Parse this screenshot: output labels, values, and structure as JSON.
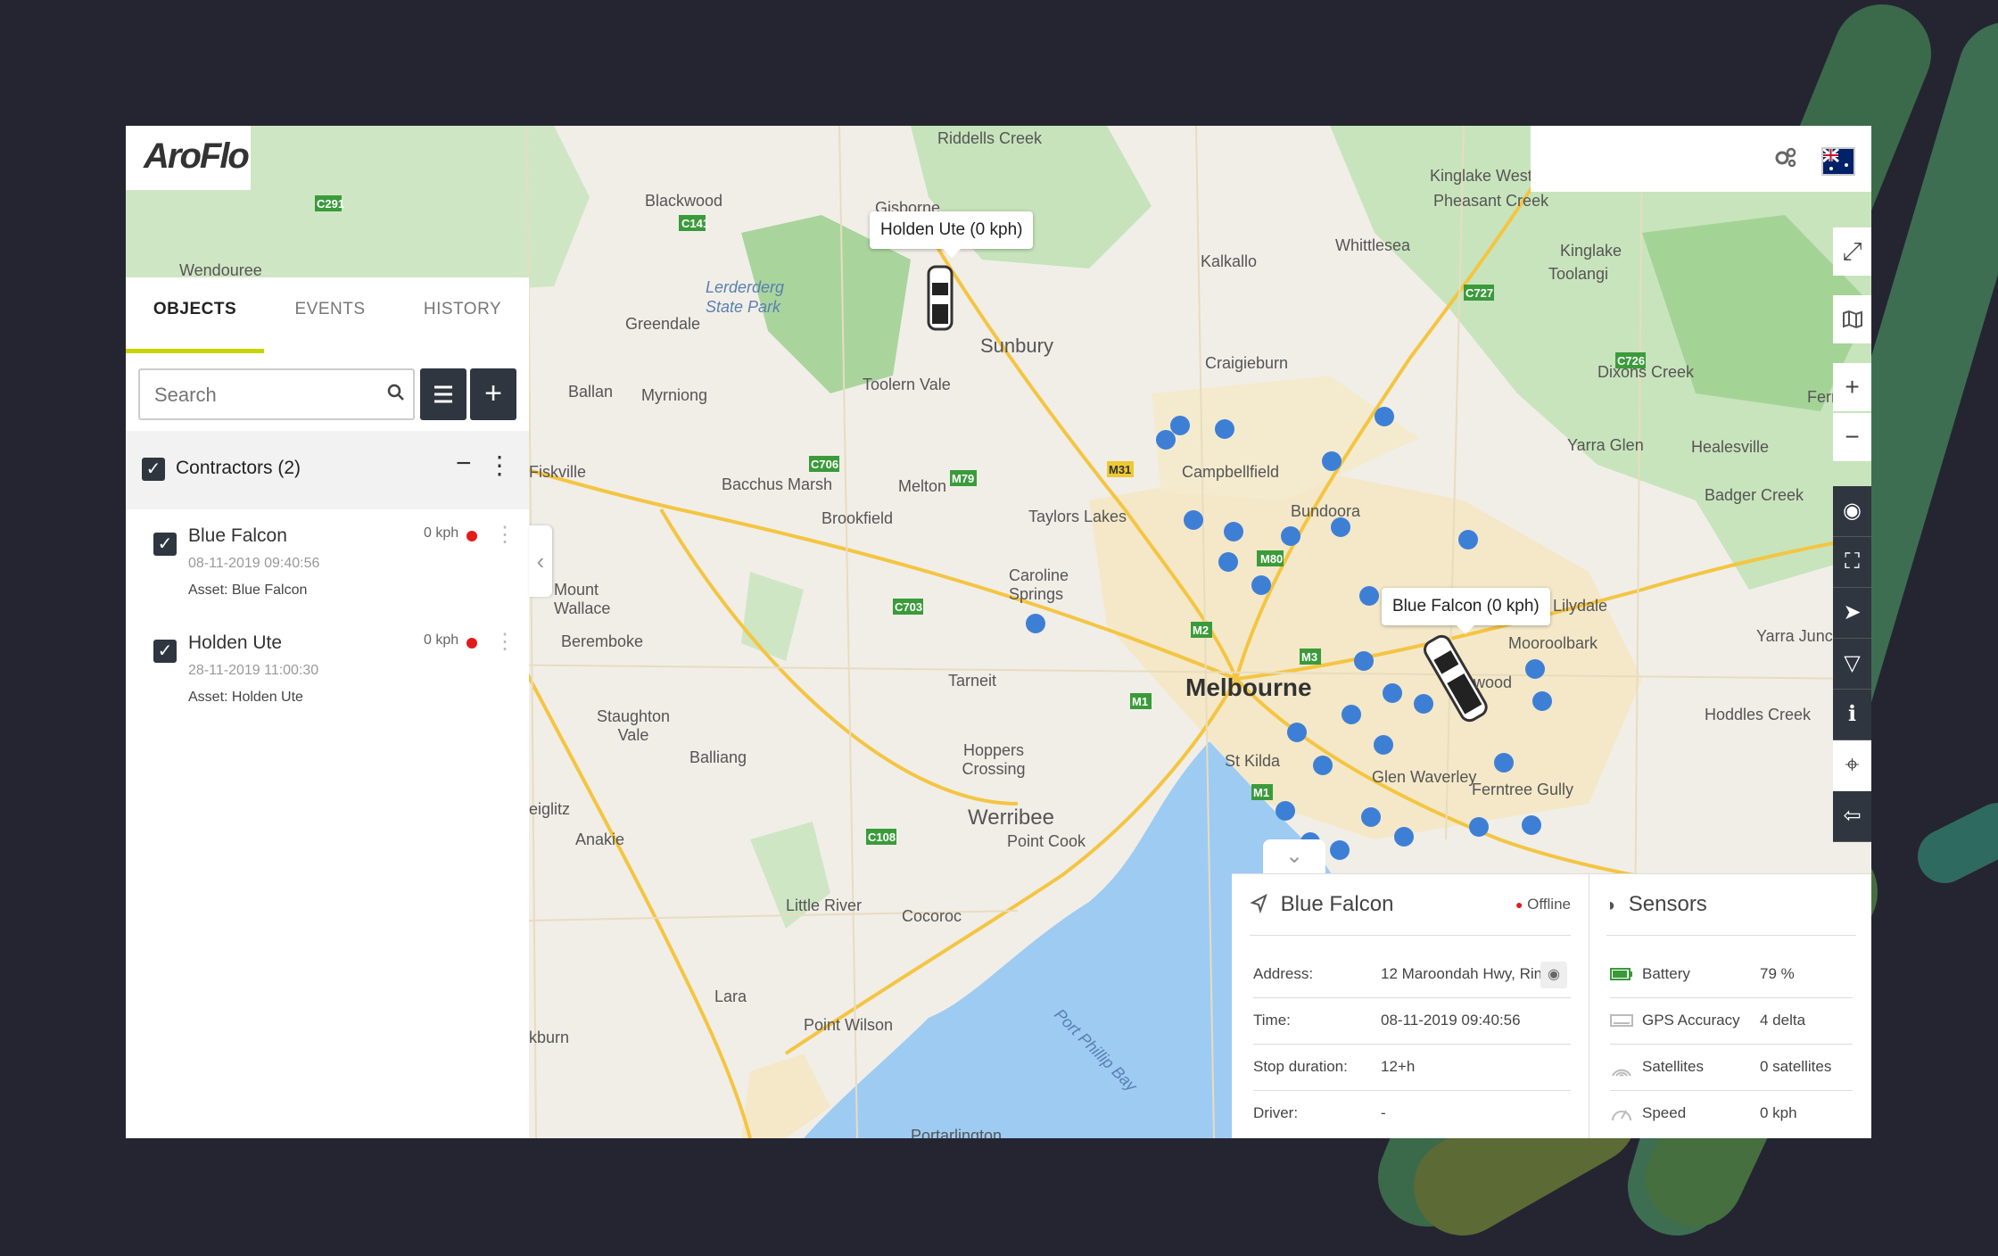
{
  "brand": {
    "logo_text": "AroFlo"
  },
  "topbar": {
    "icons": [
      "satellite-icon",
      "wrench-icon",
      "gear-icon",
      "australia-flag-icon"
    ]
  },
  "sidebar": {
    "tabs": [
      {
        "label": "OBJECTS"
      },
      {
        "label": "EVENTS"
      },
      {
        "label": "HISTORY"
      }
    ],
    "search": {
      "placeholder": "Search"
    },
    "group": {
      "label": "Contractors (2)"
    },
    "objects": [
      {
        "name": "Blue Falcon",
        "time": "08-11-2019 09:40:56",
        "asset": "Asset: Blue Falcon",
        "speed": "0 kph"
      },
      {
        "name": "Holden Ute",
        "time": "28-11-2019 11:00:30",
        "asset": "Asset: Holden Ute",
        "speed": "0 kph"
      }
    ]
  },
  "map": {
    "vehicle_labels": [
      "Holden Ute (0 kph)",
      "Blue Falcon (0 kph)"
    ],
    "places": [
      "Riddells Creek",
      "Kinglake West",
      "Pheasant Creek",
      "Blackwood",
      "Gisborne",
      "Whittlesea",
      "Kinglake",
      "Toolangi",
      "Kalkallo",
      "Wendouree",
      "Lerderderg State Park",
      "Greendale",
      "Sunbury",
      "Craigieburn",
      "Dixons Creek",
      "Ballan",
      "Myrniong",
      "Toolern Vale",
      "Yarra Glen",
      "Healesville",
      "Fern",
      "Fiskville",
      "Bacchus Marsh",
      "Melton",
      "Campbellfield",
      "Badger Creek",
      "Brookfield",
      "Taylors Lakes",
      "Bundoora",
      "Caroline Springs",
      "Mount Wallace",
      "Lilydale",
      "Yarra Junc",
      "Beremboke",
      "Mooroolbark",
      "Melbourne",
      "Tarneit",
      "Staughton Vale",
      "Hoppers Crossing",
      "Hoddles Creek",
      "Balliang",
      "St Kilda",
      "Glen Waverley",
      "Ferntree Gully",
      "eiglitz",
      "Anakie",
      "Werribee",
      "Point Cook",
      "Little River",
      "Cocoroc",
      "Lara",
      "kburn",
      "Point Wilson",
      "Port Phillip Bay",
      "Portarlington",
      "wood"
    ]
  },
  "map_tools": [
    "expand-icon",
    "map-icon",
    "zoom-in-icon",
    "zoom-out-icon",
    "layers-icon",
    "fit-icon",
    "navigate-icon",
    "filter-icon",
    "info-icon",
    "pin-icon",
    "route-icon"
  ],
  "details": {
    "title": "Blue Falcon",
    "status": "Offline",
    "rows": [
      {
        "key": "Address:",
        "value": "12 Maroondah Hwy, Rin..."
      },
      {
        "key": "Time:",
        "value": "08-11-2019 09:40:56"
      },
      {
        "key": "Stop duration:",
        "value": "12+h"
      },
      {
        "key": "Driver:",
        "value": "-"
      }
    ]
  },
  "sensors": {
    "title": "Sensors",
    "rows": [
      {
        "key": "Battery",
        "value": "79 %",
        "icon": "battery-icon"
      },
      {
        "key": "GPS Accuracy",
        "value": "4 delta",
        "icon": "gps-icon"
      },
      {
        "key": "Satellites",
        "value": "0 satellites",
        "icon": "satellite-signal-icon"
      },
      {
        "key": "Speed",
        "value": "0 kph",
        "icon": "speedometer-icon"
      }
    ]
  },
  "colors": {
    "accent": "#c8d400",
    "dark": "#2f3640",
    "offline": "#e41b1b",
    "background": "#252532"
  }
}
